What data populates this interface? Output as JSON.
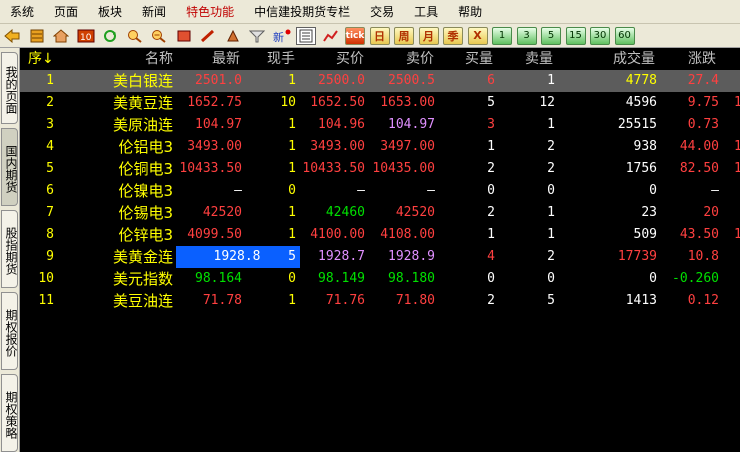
{
  "menu": [
    "系统",
    "页面",
    "板块",
    "新闻",
    "特色功能",
    "中信建投期货专栏",
    "交易",
    "工具",
    "帮助"
  ],
  "toolbar": {
    "period_labels": [
      "日",
      "周",
      "月",
      "季"
    ],
    "tick_label": "tick",
    "x_label": "X",
    "minute_labels": [
      "1",
      "3",
      "5",
      "15",
      "30",
      "60"
    ]
  },
  "sidebar": [
    "我的页面",
    "国内期货",
    "股指期货",
    "期权报价",
    "期权策略"
  ],
  "columns": [
    "序",
    "名称",
    "最新",
    "现手",
    "买价",
    "卖价",
    "买量",
    "卖量",
    "成交量",
    "涨跌"
  ],
  "rows": [
    {
      "seq": "1",
      "name": "美白银连",
      "last": "2501.0",
      "vol": "1",
      "bid": "2500.0",
      "ask": "2500.5",
      "bidv": "6",
      "askv": "1",
      "turnover": "4778",
      "chg": "27.4",
      "extra": ""
    },
    {
      "seq": "2",
      "name": "美黄豆连",
      "last": "1652.75",
      "vol": "10",
      "bid": "1652.50",
      "ask": "1653.00",
      "bidv": "5",
      "askv": "12",
      "turnover": "4596",
      "chg": "9.75",
      "extra": "1"
    },
    {
      "seq": "3",
      "name": "美原油连",
      "last": "104.97",
      "vol": "1",
      "bid": "104.96",
      "ask": "104.97",
      "bidv": "3",
      "askv": "1",
      "turnover": "25515",
      "chg": "0.73",
      "extra": ""
    },
    {
      "seq": "4",
      "name": "伦铝电3",
      "last": "3493.00",
      "vol": "1",
      "bid": "3493.00",
      "ask": "3497.00",
      "bidv": "1",
      "askv": "2",
      "turnover": "938",
      "chg": "44.00",
      "extra": "1"
    },
    {
      "seq": "5",
      "name": "伦铜电3",
      "last": "10433.50",
      "vol": "1",
      "bid": "10433.50",
      "ask": "10435.00",
      "bidv": "2",
      "askv": "2",
      "turnover": "1756",
      "chg": "82.50",
      "extra": "1"
    },
    {
      "seq": "6",
      "name": "伦镍电3",
      "last": "—",
      "vol": "0",
      "bid": "—",
      "ask": "—",
      "bidv": "0",
      "askv": "0",
      "turnover": "0",
      "chg": "—",
      "extra": ""
    },
    {
      "seq": "7",
      "name": "伦锡电3",
      "last": "42520",
      "vol": "1",
      "bid": "42460",
      "ask": "42520",
      "bidv": "2",
      "askv": "1",
      "turnover": "23",
      "chg": "20",
      "extra": ""
    },
    {
      "seq": "8",
      "name": "伦锌电3",
      "last": "4099.50",
      "vol": "1",
      "bid": "4100.00",
      "ask": "4108.00",
      "bidv": "1",
      "askv": "1",
      "turnover": "509",
      "chg": "43.50",
      "extra": "1"
    },
    {
      "seq": "9",
      "name": "美黄金连",
      "last": "1928.8",
      "vol": "5",
      "bid": "1928.7",
      "ask": "1928.9",
      "bidv": "4",
      "askv": "2",
      "turnover": "17739",
      "chg": "10.8",
      "extra": ""
    },
    {
      "seq": "10",
      "name": "美元指数",
      "last": "98.164",
      "vol": "0",
      "bid": "98.149",
      "ask": "98.180",
      "bidv": "0",
      "askv": "0",
      "turnover": "0",
      "chg": "-0.260",
      "extra": ""
    },
    {
      "seq": "11",
      "name": "美豆油连",
      "last": "71.78",
      "vol": "1",
      "bid": "71.76",
      "ask": "71.80",
      "bidv": "2",
      "askv": "5",
      "turnover": "1413",
      "chg": "0.12",
      "extra": ""
    }
  ],
  "colors": {
    "up": "#ff4040",
    "down": "#00e000",
    "neutral": "#ffffff",
    "name": "#ffff00",
    "highlight": "#0a60ff",
    "selected_row": "#5c5c5c"
  }
}
